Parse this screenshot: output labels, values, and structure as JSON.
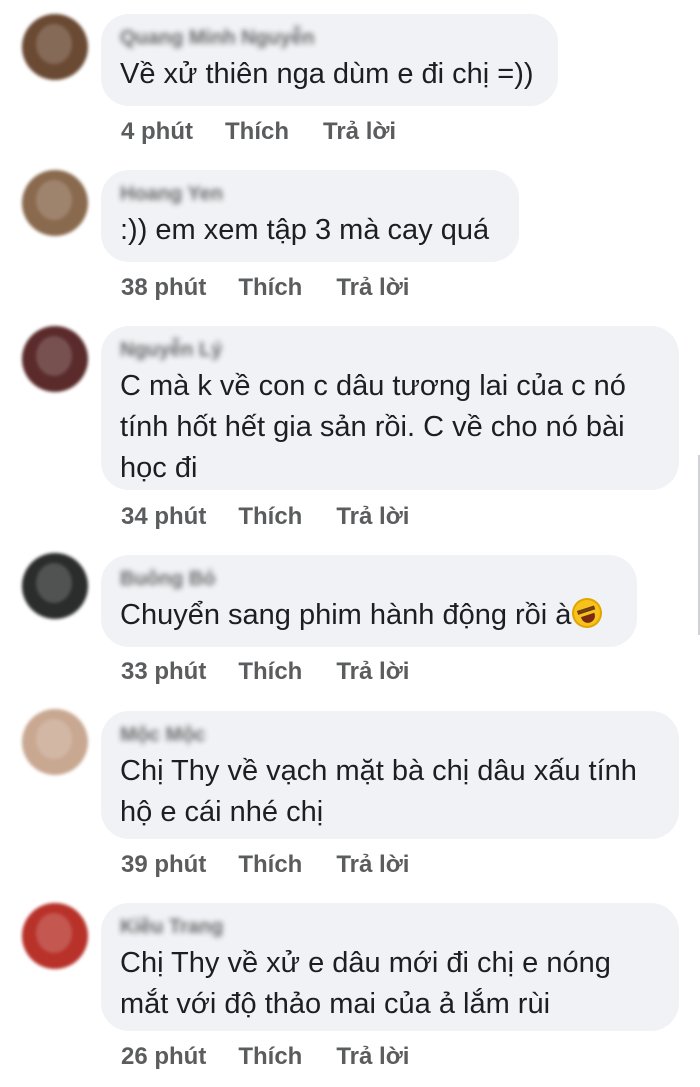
{
  "comments": [
    {
      "author": "Quang Minh Nguyễn",
      "text": "Về xử thiên nga dùm e đi chị =))",
      "time": "4 phút",
      "like": "Thích",
      "reply": "Trả lời",
      "avatar_color": "#6b4a34"
    },
    {
      "author": "Hoang Yen",
      "text": ":)) em xem tập 3 mà cay quá",
      "time": "38 phút",
      "like": "Thích",
      "reply": "Trả lời",
      "avatar_color": "#8a6a4e"
    },
    {
      "author": "Nguyễn Lý",
      "text_lines": [
        "C mà k về con c dâu tương lai của c nó",
        "tính hốt hết gia sản rồi. C về cho nó bài",
        "học đi"
      ],
      "time": "34 phút",
      "like": "Thích",
      "reply": "Trả lời",
      "avatar_color": "#5a2b2a"
    },
    {
      "author": "Buông Bỏ",
      "text": "Chuyển sang phim hành động rồi à",
      "emoji": "rolling-on-floor-laughing-emoji",
      "time": "33 phút",
      "like": "Thích",
      "reply": "Trả lời",
      "avatar_color": "#2b2d2c"
    },
    {
      "author": "Mộc Mộc",
      "text_lines": [
        "Chị Thy về vạch mặt bà chị dâu xấu tính",
        "hộ e cái nhé chị"
      ],
      "time": "39 phút",
      "like": "Thích",
      "reply": "Trả lời",
      "avatar_color": "#c9a892"
    },
    {
      "author": "Kiều Trang",
      "text_lines": [
        "Chị Thy về xử e dâu mới đi chị e nóng",
        "mắt với độ thảo mai của ả lắm rùi"
      ],
      "time": "26 phút",
      "like": "Thích",
      "reply": "Trả lời",
      "avatar_color": "#b8322a"
    }
  ]
}
